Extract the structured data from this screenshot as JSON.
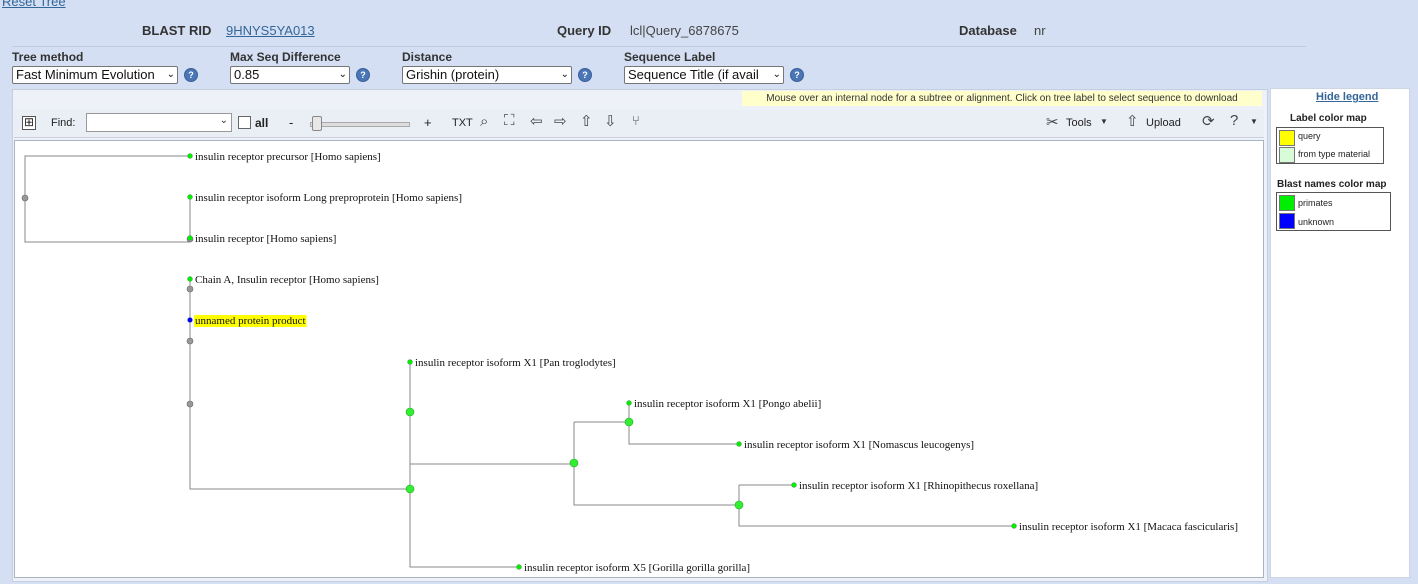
{
  "header": {
    "reset_link": "Reset Tree",
    "blast_rid_label": "BLAST RID",
    "blast_rid_value": "9HNYS5YA013",
    "query_id_label": "Query ID",
    "query_id_value": "lcl|Query_6878675",
    "database_label": "Database",
    "database_value": "nr"
  },
  "controls": {
    "tree_method": {
      "label": "Tree method",
      "value": "Fast Minimum Evolution"
    },
    "max_seq_diff": {
      "label": "Max Seq Difference",
      "value": "0.85"
    },
    "distance": {
      "label": "Distance",
      "value": "Grishin (protein)"
    },
    "seq_label": {
      "label": "Sequence Label",
      "value": "Sequence Title (if avail"
    }
  },
  "viewer": {
    "hint": "Mouse over an internal node for a subtree or alignment. Click on tree label to select sequence to download",
    "toolbar": {
      "expand": "⊞",
      "find_label": "Find:",
      "find_placeholder": "",
      "all_label": "all",
      "zoom_out": "-",
      "zoom_in": "+",
      "txt": "TXT",
      "tools": "Tools",
      "upload": "Upload"
    }
  },
  "tree": {
    "leaves": [
      {
        "label": "insulin receptor precursor [Homo sapiens]",
        "color": "#00ee00",
        "query": false
      },
      {
        "label": "insulin receptor isoform Long preproprotein [Homo sapiens]",
        "color": "#00ee00",
        "query": false
      },
      {
        "label": "insulin receptor [Homo sapiens]",
        "color": "#00ee00",
        "query": false
      },
      {
        "label": "Chain A, Insulin receptor [Homo sapiens]",
        "color": "#00ee00",
        "query": false
      },
      {
        "label": "unnamed protein product",
        "color": "#0000ff",
        "query": true
      },
      {
        "label": "insulin receptor isoform X1 [Pan troglodytes]",
        "color": "#00ee00",
        "query": false
      },
      {
        "label": "insulin receptor isoform X1 [Pongo abelii]",
        "color": "#00ee00",
        "query": false
      },
      {
        "label": "insulin receptor isoform X1 [Nomascus leucogenys]",
        "color": "#00ee00",
        "query": false
      },
      {
        "label": "insulin receptor isoform X1 [Rhinopithecus roxellana]",
        "color": "#00ee00",
        "query": false
      },
      {
        "label": "insulin receptor isoform X1 [Macaca fascicularis]",
        "color": "#00ee00",
        "query": false
      },
      {
        "label": "insulin receptor isoform X5 [Gorilla gorilla gorilla]",
        "color": "#00ee00",
        "query": false
      }
    ]
  },
  "legend": {
    "hide_link": "Hide legend",
    "label_map_title": "Label color map",
    "label_map": [
      {
        "label": "query",
        "color": "#ffff00"
      },
      {
        "label": "from type material",
        "color": "#d8fcd8"
      }
    ],
    "blast_map_title": "Blast names color map",
    "blast_map": [
      {
        "label": "primates",
        "color": "#00ee00"
      },
      {
        "label": "unknown",
        "color": "#0000ff"
      }
    ]
  },
  "colors": {
    "background": "#d4dff3",
    "link": "#336699",
    "query_highlight": "#ffff00",
    "internal_node": "#999999"
  }
}
